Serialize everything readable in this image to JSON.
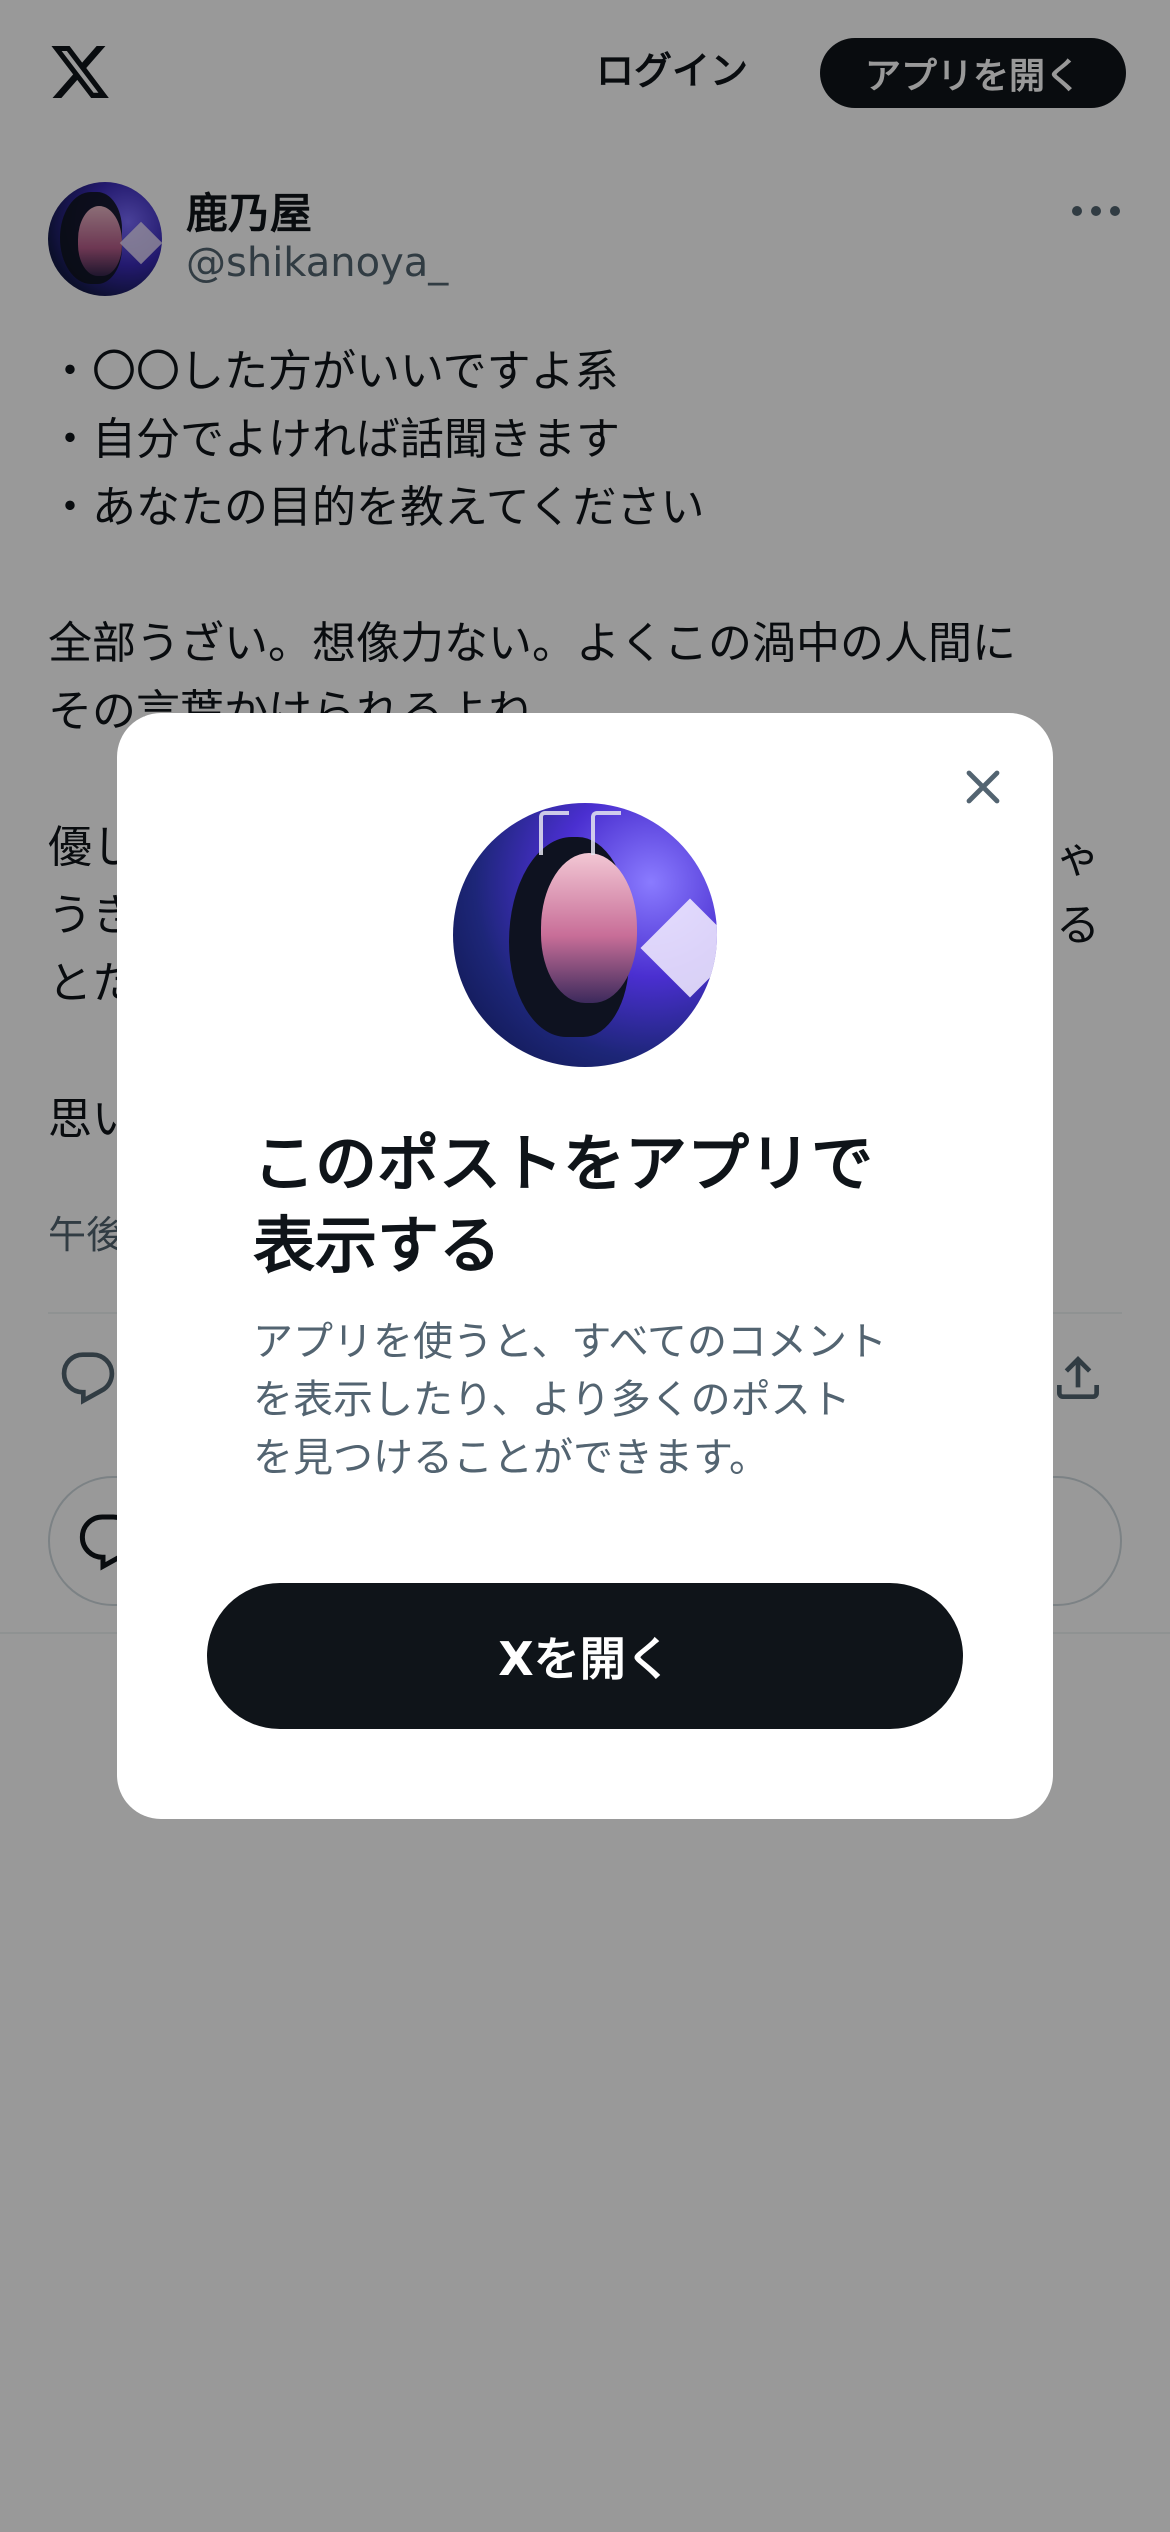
{
  "header": {
    "logo_icon": "x-logo-icon",
    "login_label": "ログイン",
    "open_app_label": "アプリを開く"
  },
  "post": {
    "author": {
      "display_name": "鹿乃屋",
      "handle": "@shikanoya_"
    },
    "lines": [
      "・〇〇した方がいいですよ系",
      "・自分でよければ話聞きます",
      "・あなたの目的を教えてください",
      "",
      "全部うざい。想像力ない。よくこの渦中の人間に",
      "その言葉かけられるよね",
      "",
      "優し",
      "うき",
      "とた",
      "",
      "思い"
    ],
    "right_fragments": [
      "ゃ",
      "る"
    ],
    "timestamp": "午後",
    "icons": {
      "reply": "reply-icon",
      "share": "share-icon",
      "more": "more-icon"
    }
  },
  "modal": {
    "close_icon": "close-icon",
    "title_lines": [
      "このポストをアプリで",
      "表示する"
    ],
    "description_lines": [
      "アプリを使うと、すべてのコメント",
      "を表示したり、より多くのポスト",
      "を見つけることができます。"
    ],
    "cta_label": "Xを開く"
  },
  "colors": {
    "text": "#0f1419",
    "secondary": "#536471",
    "button_bg": "#0f1419",
    "overlay": "rgba(0,0,0,0.4)"
  }
}
